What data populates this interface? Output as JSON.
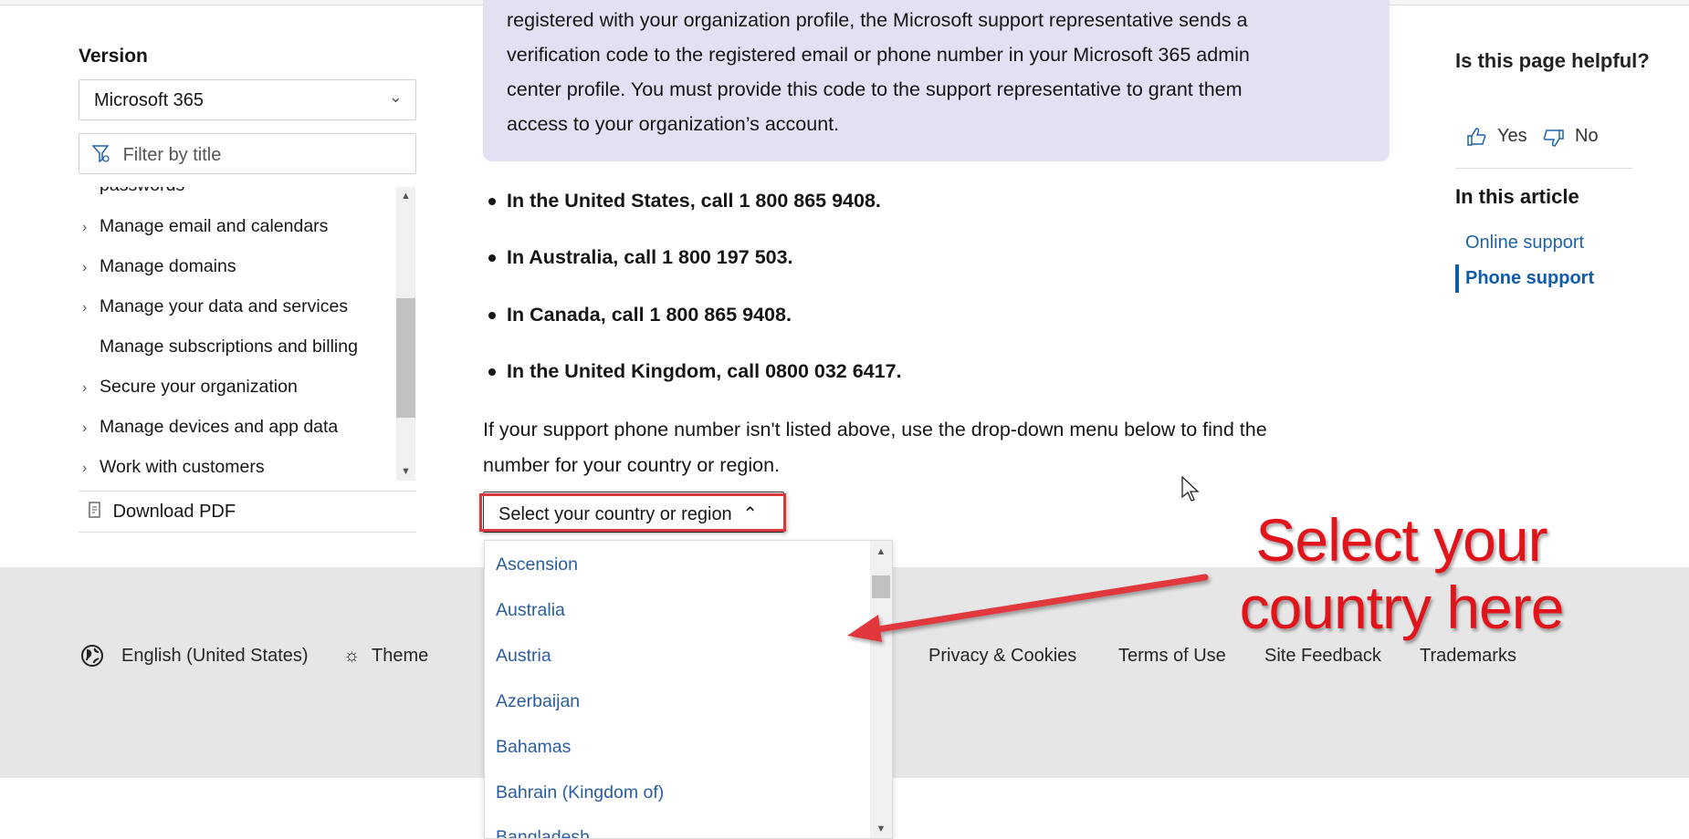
{
  "sidebar": {
    "version_label": "Version",
    "version_value": "Microsoft 365",
    "filter_placeholder": "Filter by title",
    "items": [
      {
        "label": "passwords",
        "expandable": false
      },
      {
        "label": "Manage email and calendars",
        "expandable": true
      },
      {
        "label": "Manage domains",
        "expandable": true
      },
      {
        "label": "Manage your data and services",
        "expandable": true
      },
      {
        "label": "Manage subscriptions and billing",
        "expandable": false
      },
      {
        "label": "Secure your organization",
        "expandable": true
      },
      {
        "label": "Manage devices and app data",
        "expandable": true
      },
      {
        "label": "Work with customers",
        "expandable": true
      }
    ],
    "download_pdf": "Download PDF"
  },
  "main": {
    "note_lines": [
      "registered with your organization profile, the Microsoft support representative sends a",
      "verification code to the registered email or phone number in your Microsoft 365 admin",
      "center profile. You must provide this code to the support representative to grant them",
      "access to your organization’s account."
    ],
    "bullets": [
      "In the United States, call 1 800 865 9408.",
      "In Australia, call 1 800 197 503.",
      "In Canada, call 1 800 865 9408.",
      "In the United Kingdom, call 0800 032 6417."
    ],
    "paragraph_lines": [
      "If your support phone number isn't listed above, use the drop-down menu below to find the",
      "number for your country or region."
    ],
    "country_select_label": "Select your country or region",
    "country_options": [
      "Ascension",
      "Australia",
      "Austria",
      "Azerbaijan",
      "Bahamas",
      "Bahrain (Kingdom of)",
      "Bangladesh"
    ]
  },
  "right": {
    "helpful_title": "Is this page helpful?",
    "yes": "Yes",
    "no": "No",
    "in_this_article": "In this article",
    "toc": [
      "Online support",
      "Phone support"
    ],
    "active_toc": "Phone support"
  },
  "footer": {
    "language": "English (United States)",
    "theme": "Theme",
    "links": [
      "Privacy & Cookies",
      "Terms of Use",
      "Site Feedback",
      "Trademarks"
    ]
  },
  "annotation": {
    "text_line1": "Select your",
    "text_line2": "country here",
    "color": "#e0141a"
  },
  "colors": {
    "note_bg": "#e5dff3",
    "link": "#1f62a8",
    "footer_bg": "#e6e6e6"
  }
}
